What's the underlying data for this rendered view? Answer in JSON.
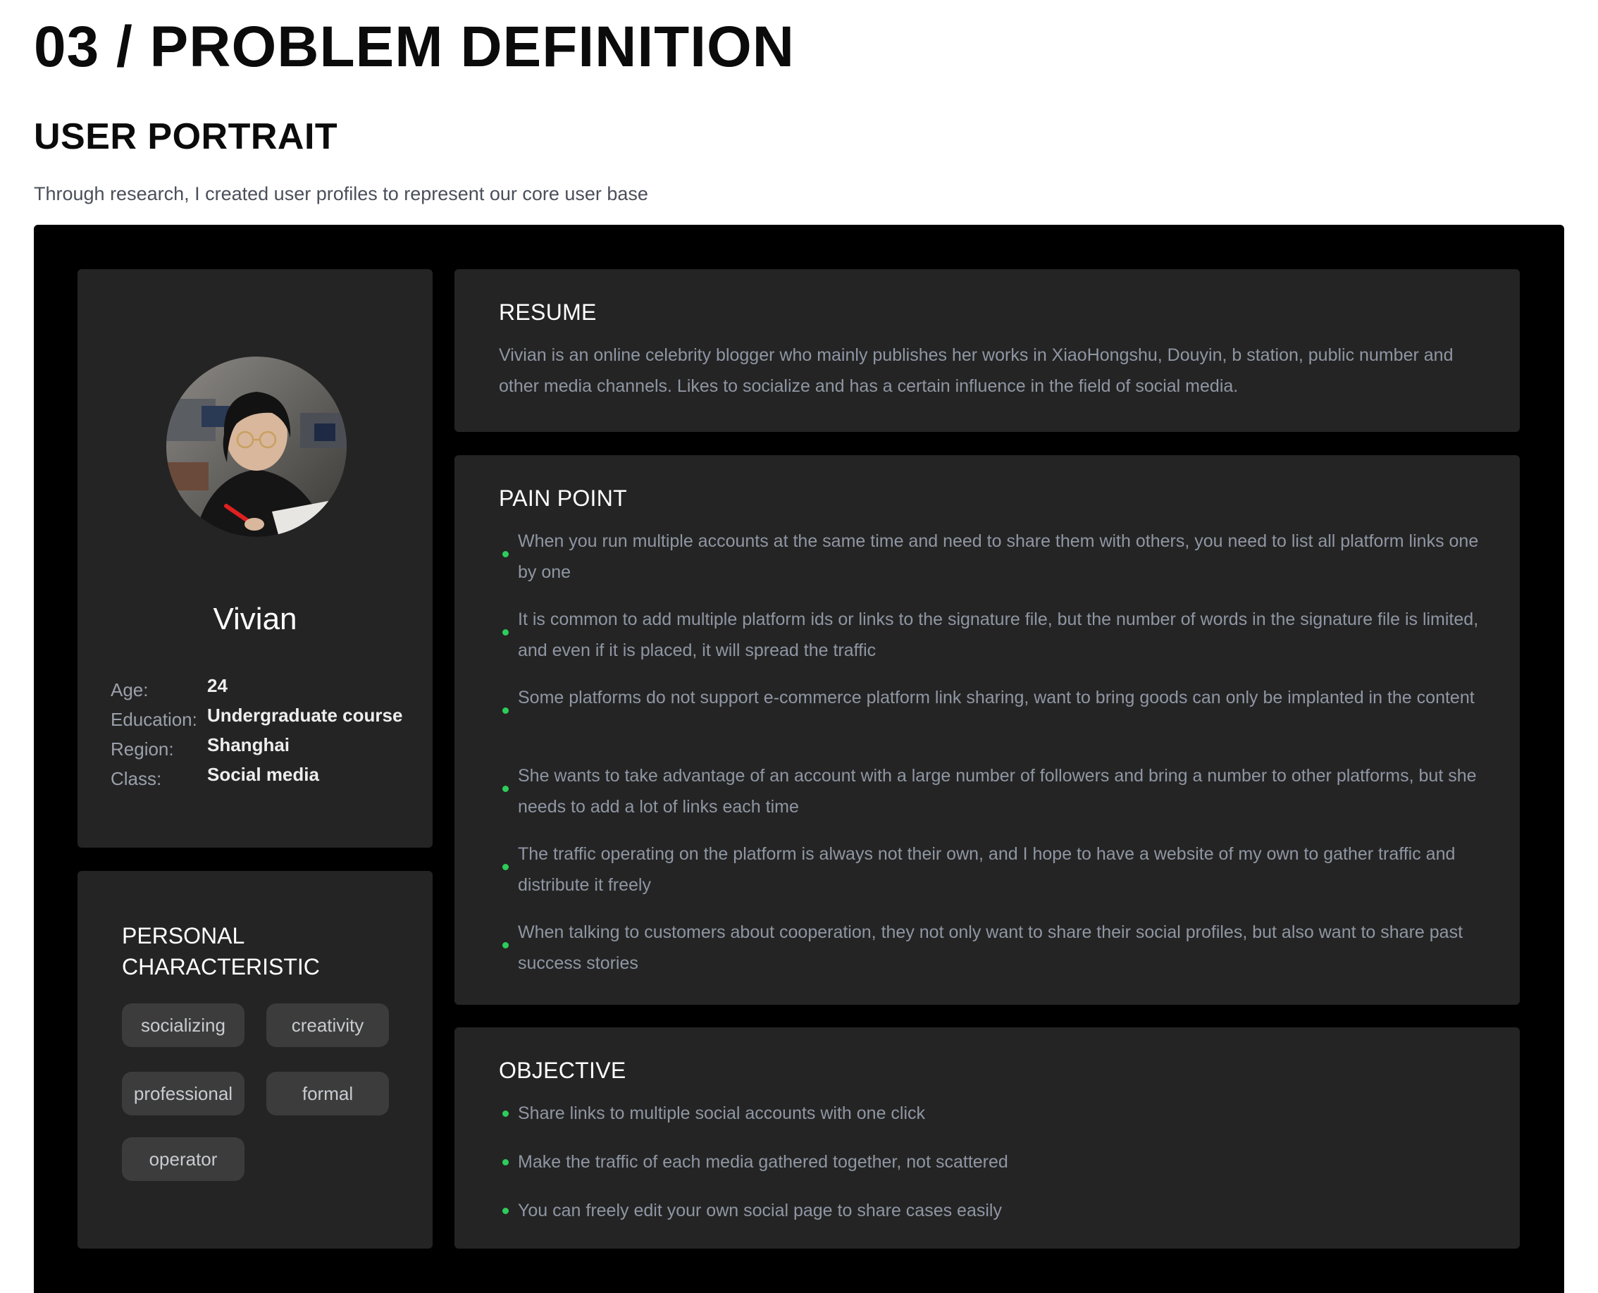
{
  "header": {
    "page_title": "03 / PROBLEM DEFINITION",
    "section_title": "USER PORTRAIT",
    "section_subtitle": "Through research, I created user profiles to represent our core user base"
  },
  "profile": {
    "name": "Vivian",
    "info": [
      {
        "key": "Age:",
        "value": "24"
      },
      {
        "key": "Education:",
        "value": "Undergraduate course"
      },
      {
        "key": "Region:",
        "value": "Shanghai"
      },
      {
        "key": "Class:",
        "value": "Social media"
      }
    ]
  },
  "traits": {
    "title": "PERSONAL CHARACTERISTIC",
    "tags": [
      "socializing",
      "creativity",
      "professional",
      "formal",
      "operator"
    ]
  },
  "resume": {
    "title": "RESUME",
    "text": "Vivian is an online celebrity blogger who mainly publishes her works in XiaoHongshu, Douyin, b station, public number and other media channels. Likes to socialize and has a certain influence in the field of social media."
  },
  "pain_point": {
    "title": "PAIN POINT",
    "items": [
      "When you run multiple accounts at the same time and need to share them with others, you need to list all platform links one by one",
      "It is common to add multiple platform ids or links to the signature file, but the number of words in the signature file is limited, and even if it is placed, it will spread the traffic",
      "Some platforms do not support e-commerce platform link sharing, want to bring goods can only be implanted in the content",
      "She wants to take advantage of an account with a large number of followers and bring a number to other platforms, but she needs to add a lot of links each time",
      "The traffic operating on the platform is always not their own, and I hope to have a website of my own to gather traffic and distribute it freely",
      "When talking to customers about cooperation, they not only want to share their social profiles, but also want to share past success stories"
    ]
  },
  "objective": {
    "title": "OBJECTIVE",
    "items": [
      "Share links to multiple social accounts with one click",
      "Make the traffic of each media gathered together, not scattered",
      "You can freely edit your own social page to share cases easily"
    ]
  },
  "colors": {
    "board": "#000000",
    "card": "#242424",
    "tag": "#3c3c3c",
    "bullet": "#2ecc5a",
    "muted_text": "#8f96a3"
  }
}
